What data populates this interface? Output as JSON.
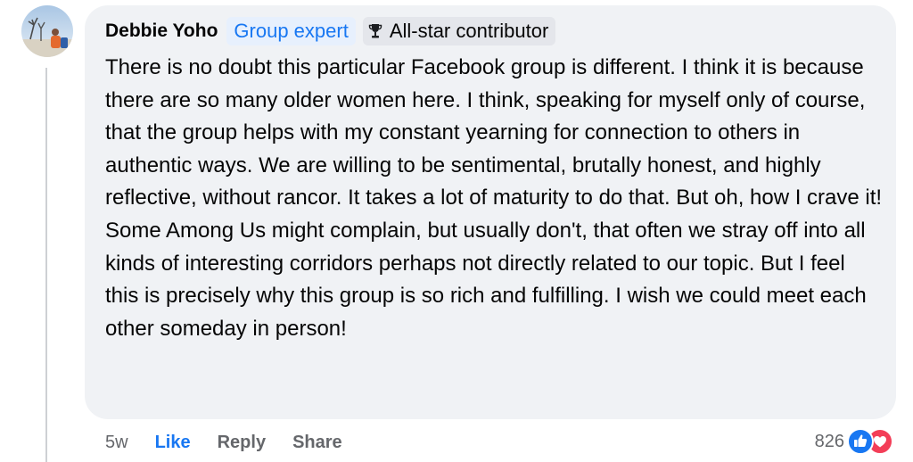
{
  "comment": {
    "author": "Debbie Yoho",
    "badges": {
      "group_expert": "Group expert",
      "all_star": "All-star contributor",
      "all_star_icon": "trophy-icon"
    },
    "text": "There is no doubt this particular Facebook group is different. I think it is because there are so many older women here. I think, speaking for myself only of course, that the group helps with my constant yearning for connection to others in authentic ways. We are willing to be sentimental, brutally honest, and highly reflective, without rancor. It takes a lot of maturity to do that. But oh, how I crave it! Some Among Us might complain, but usually don't, that often we stray off into all kinds of interesting corridors perhaps not directly related to our topic. But I feel this is precisely why this group is so rich and fulfilling. I wish we could meet each other someday in person!",
    "timestamp": "5w",
    "actions": {
      "like": "Like",
      "reply": "Reply",
      "share": "Share"
    },
    "reactions": {
      "count": "826",
      "icons": [
        "like-reaction-icon",
        "love-reaction-icon"
      ]
    }
  },
  "colors": {
    "accent": "#1877f2",
    "bubble_bg": "#f0f2f5",
    "secondary_text": "#65676b",
    "love": "#f33e58"
  }
}
